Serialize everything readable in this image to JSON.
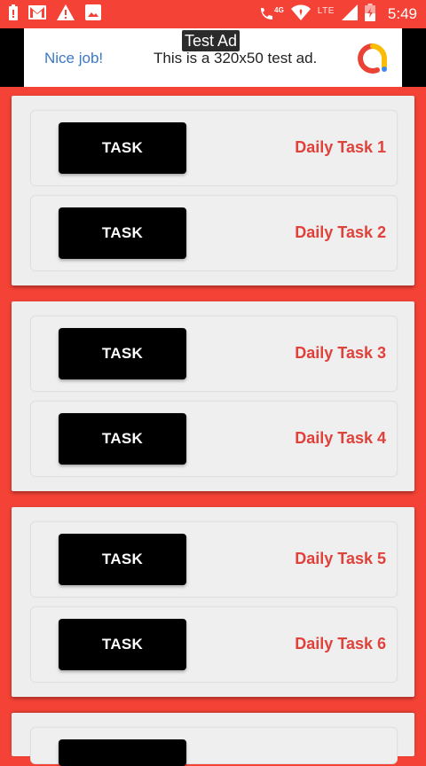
{
  "status_bar": {
    "time": "5:49",
    "network_label": "LTE",
    "call_label": "4G",
    "icons": [
      "alert-icon",
      "gmail-icon",
      "warning-icon",
      "image-icon",
      "wifi-calling-icon",
      "signal-icon",
      "battery-icon"
    ]
  },
  "ad": {
    "label": "Test Ad",
    "left_text": "Nice job!",
    "main_text": "This is a 320x50 test ad."
  },
  "cards": [
    {
      "tasks": [
        {
          "button": "TASK",
          "label": "Daily Task 1"
        },
        {
          "button": "TASK",
          "label": "Daily Task 2"
        }
      ]
    },
    {
      "tasks": [
        {
          "button": "TASK",
          "label": "Daily Task 3"
        },
        {
          "button": "TASK",
          "label": "Daily Task 4"
        }
      ]
    },
    {
      "tasks": [
        {
          "button": "TASK",
          "label": "Daily Task 5"
        },
        {
          "button": "TASK",
          "label": "Daily Task 6"
        }
      ]
    },
    {
      "tasks": [
        {
          "button": "",
          "label": ""
        }
      ]
    }
  ],
  "colors": {
    "accent": "#f44336",
    "task_label": "#e0413a",
    "button": "#000000",
    "card": "#eeeeee"
  }
}
